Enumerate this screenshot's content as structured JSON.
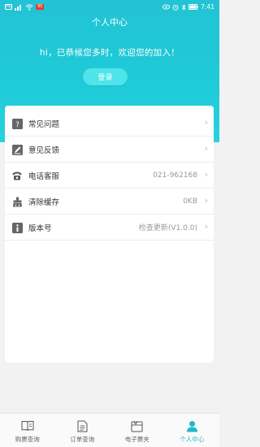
{
  "status_bar": {
    "left_badge": "HD",
    "signal_text": "4G",
    "battery_badge": "95",
    "time": "7:41"
  },
  "header": {
    "title": "个人中心",
    "welcome": "hi，已恭候您多时，欢迎您的加入！",
    "login_label": "登录"
  },
  "menu": {
    "items": [
      {
        "label": "常见问题",
        "value": "",
        "icon": "question-icon"
      },
      {
        "label": "意见反馈",
        "value": "",
        "icon": "edit-icon"
      },
      {
        "label": "电话客服",
        "value": "021-962168",
        "icon": "phone-icon"
      },
      {
        "label": "清除缓存",
        "value": "0KB",
        "icon": "clear-cache-icon"
      },
      {
        "label": "版本号",
        "value": "检查更新(V1.0.0)",
        "icon": "info-icon"
      }
    ]
  },
  "tabbar": {
    "tabs": [
      {
        "label": "购票查询",
        "icon": "book-icon"
      },
      {
        "label": "订单查询",
        "icon": "document-icon"
      },
      {
        "label": "电子票夹",
        "icon": "ticket-folder-icon"
      },
      {
        "label": "个人中心",
        "icon": "user-icon"
      }
    ],
    "active_index": 3
  },
  "colors": {
    "header_teal": "#22c3d4",
    "login_button": "#4fe3ea",
    "active_tab": "#1fb9cb",
    "background": "#f2f2f2"
  }
}
